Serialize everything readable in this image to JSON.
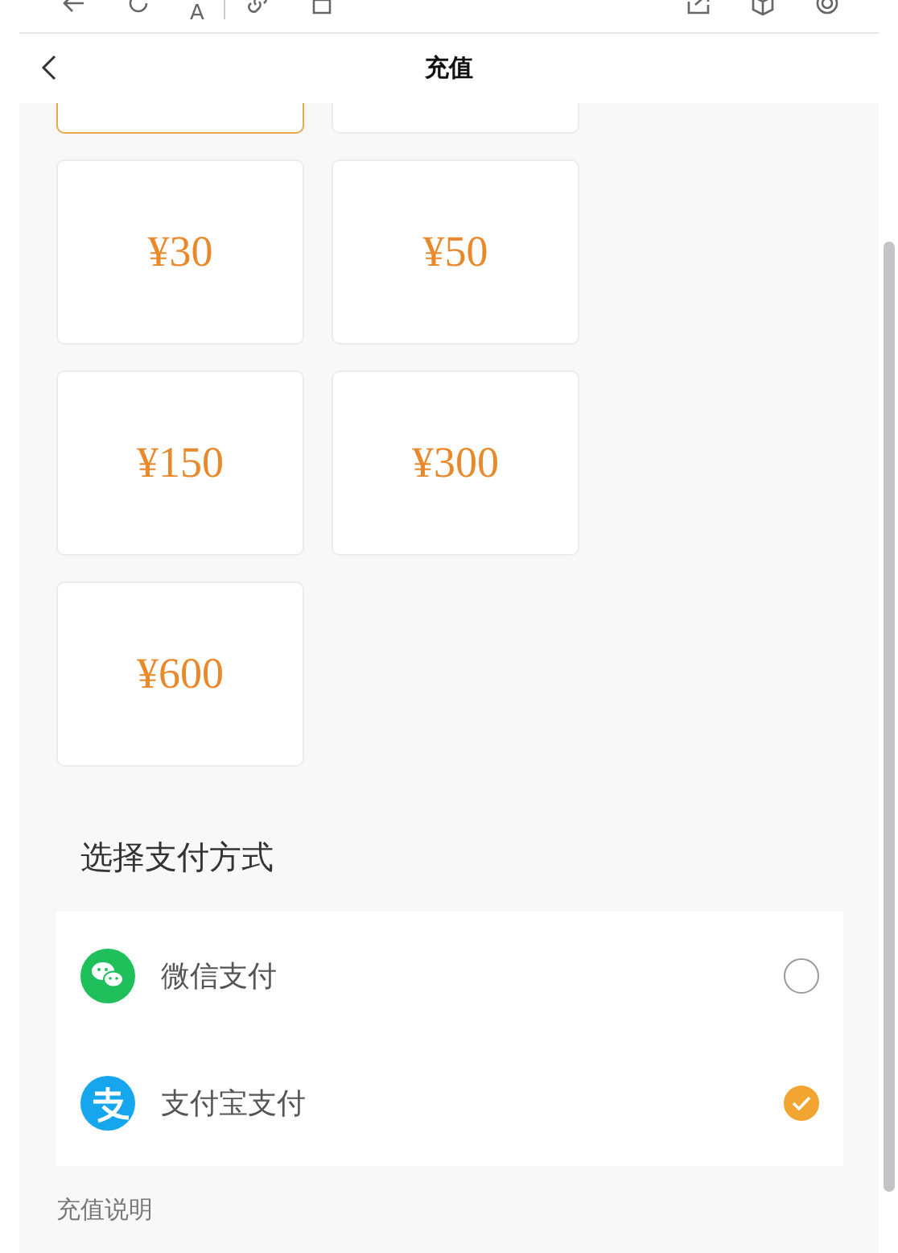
{
  "toolbar": {
    "font_label": "A"
  },
  "header": {
    "title": "充值"
  },
  "amounts": [
    {
      "selected": true,
      "partial": true
    },
    {
      "selected": false,
      "partial": true
    },
    {
      "amount": "¥30",
      "selected": false,
      "partial": false
    },
    {
      "amount": "¥50",
      "selected": false,
      "partial": false
    },
    {
      "amount": "¥150",
      "selected": false,
      "partial": false
    },
    {
      "amount": "¥300",
      "selected": false,
      "partial": false
    },
    {
      "amount": "¥600",
      "selected": false,
      "partial": false
    }
  ],
  "payment": {
    "heading": "选择支付方式",
    "methods": [
      {
        "kind": "wechat",
        "label": "微信支付",
        "selected": false
      },
      {
        "kind": "alipay",
        "label": "支付宝支付",
        "selected": true
      }
    ]
  },
  "notes_heading": "充值说明"
}
